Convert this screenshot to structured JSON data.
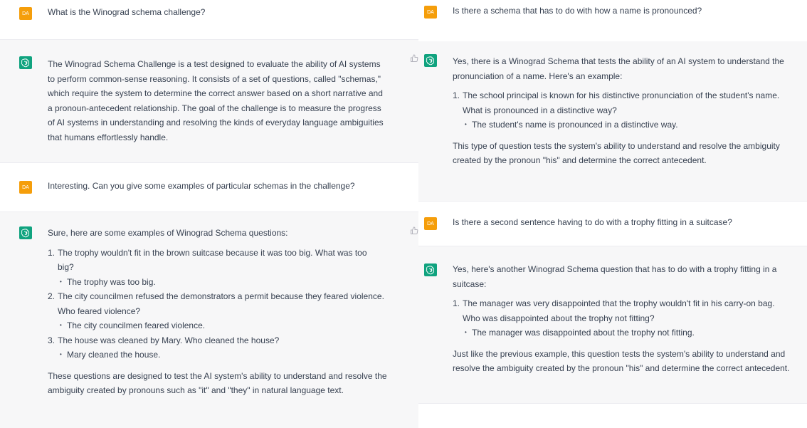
{
  "avatar": {
    "user_initials": "DA"
  },
  "left": {
    "m1_user": "What is the Winograd schema challenge?",
    "m2_bot": [
      "The Winograd Schema Challenge is a test designed to evaluate the ability of AI systems",
      "to perform common-sense reasoning. It consists of a set of questions, called \"schemas,\"",
      "which require the system to determine the correct answer based on a short narrative and",
      "a pronoun-antecedent relationship. The goal of the challenge is to measure the progress",
      "of AI systems in understanding and resolving the kinds of everyday language ambiguities",
      "that humans effortlessly handle."
    ],
    "m3_user": "Interesting. Can you give some examples of particular schemas in the challenge?",
    "m4_bot": {
      "intro": "Sure, here are some examples of Winograd Schema questions:",
      "items": [
        {
          "num": "1.",
          "lines": [
            "The trophy wouldn't fit in the brown suitcase because it was too big. What was too",
            "big?"
          ],
          "answer": "The trophy was too big."
        },
        {
          "num": "2.",
          "lines": [
            "The city councilmen refused the demonstrators a permit because they feared violence.",
            "Who feared violence?"
          ],
          "answer": "The city councilmen feared violence."
        },
        {
          "num": "3.",
          "lines": [
            "The house was cleaned by Mary. Who cleaned the house?"
          ],
          "answer": "Mary cleaned the house."
        }
      ],
      "outro": [
        "These questions are designed to test the AI system's ability to understand and resolve the",
        "ambiguity created by pronouns such as \"it\" and \"they\" in natural language text."
      ]
    }
  },
  "right": {
    "m1_user": "Is there a schema that has to do with how a name is pronounced?",
    "m2_bot": {
      "intro": [
        "Yes, there is a Winograd Schema that tests the ability of an AI system to understand the",
        "pronunciation of a name. Here's an example:"
      ],
      "items": [
        {
          "num": "1.",
          "lines": [
            "The school principal is known for his distinctive pronunciation of the student's name.",
            "What is pronounced in a distinctive way?"
          ],
          "answer": "The student's name is pronounced in a distinctive way."
        }
      ],
      "outro": [
        "This type of question tests the system's ability to understand and resolve the ambiguity",
        "created by the pronoun \"his\" and determine the correct antecedent."
      ]
    },
    "m3_user": "Is there a second sentence having to do with a trophy fitting in a suitcase?",
    "m4_bot": {
      "intro": [
        "Yes, here's another Winograd Schema question that has to do with a trophy fitting in a",
        "suitcase:"
      ],
      "items": [
        {
          "num": "1.",
          "lines": [
            "The manager was very disappointed that the trophy wouldn't fit in his carry-on bag.",
            "Who was disappointed about the trophy not fitting?"
          ],
          "answer": "The manager was disappointed about the trophy not fitting."
        }
      ],
      "outro": [
        "Just like the previous example, this question tests the system's ability to understand and",
        "resolve the ambiguity created by the pronoun \"his\" and determine the correct antecedent."
      ]
    }
  },
  "colors": {
    "user_avatar": "#f59e0b",
    "bot_avatar": "#10a37f",
    "bot_bg": "#f7f7f8",
    "text": "#374151"
  }
}
